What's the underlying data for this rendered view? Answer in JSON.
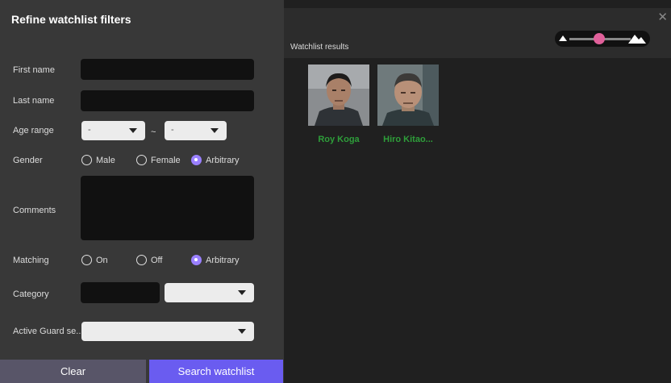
{
  "filters": {
    "title": "Refine watchlist filters",
    "first_name_label": "First name",
    "last_name_label": "Last name",
    "age_range_label": "Age range",
    "age_from": "-",
    "age_tilde": "~",
    "age_to": "-",
    "gender_label": "Gender",
    "gender_options": [
      "Male",
      "Female",
      "Arbitrary"
    ],
    "gender_selected": "Arbitrary",
    "comments_label": "Comments",
    "matching_label": "Matching",
    "matching_options": [
      "On",
      "Off",
      "Arbitrary"
    ],
    "matching_selected": "Arbitrary",
    "category_label": "Category",
    "active_guard_label": "Active Guard se...",
    "clear_label": "Clear",
    "search_label": "Search watchlist"
  },
  "results": {
    "label": "Watchlist results",
    "items": [
      {
        "name": "Roy Koga"
      },
      {
        "name": "Hiro Kitao..."
      }
    ]
  },
  "colors": {
    "accent": "#6a5cf0",
    "name_green": "#2e9e3a",
    "slider_thumb": "#e0609a"
  }
}
